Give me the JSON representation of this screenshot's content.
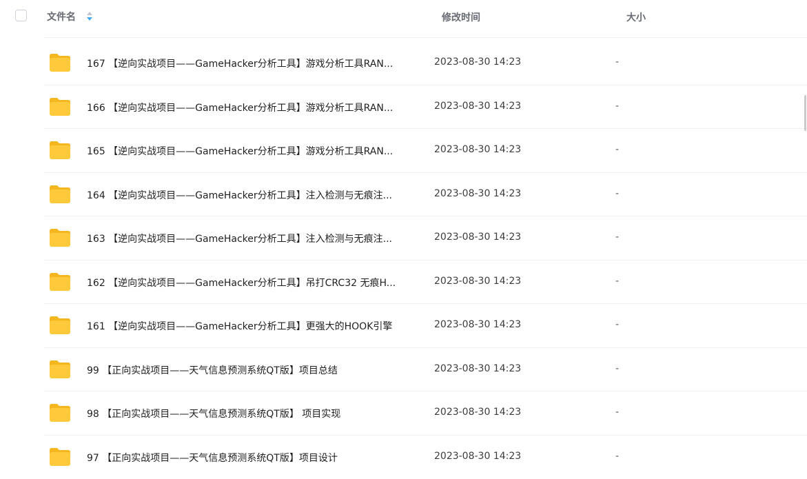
{
  "header": {
    "name_label": "文件名",
    "time_label": "修改时间",
    "size_label": "大小"
  },
  "files": [
    {
      "name": "167 【逆向实战项目——GameHacker分析工具】游戏分析工具RAN...",
      "time": "2023-08-30 14:23",
      "size": "-"
    },
    {
      "name": "166 【逆向实战项目——GameHacker分析工具】游戏分析工具RAN...",
      "time": "2023-08-30 14:23",
      "size": "-"
    },
    {
      "name": "165 【逆向实战项目——GameHacker分析工具】游戏分析工具RAN...",
      "time": "2023-08-30 14:23",
      "size": "-"
    },
    {
      "name": "164 【逆向实战项目——GameHacker分析工具】注入检测与无痕注...",
      "time": "2023-08-30 14:23",
      "size": "-"
    },
    {
      "name": "163 【逆向实战项目——GameHacker分析工具】注入检测与无痕注...",
      "time": "2023-08-30 14:23",
      "size": "-"
    },
    {
      "name": "162 【逆向实战项目——GameHacker分析工具】吊打CRC32 无痕H...",
      "time": "2023-08-30 14:23",
      "size": "-"
    },
    {
      "name": "161 【逆向实战项目——GameHacker分析工具】更强大的HOOK引擎",
      "time": "2023-08-30 14:23",
      "size": "-"
    },
    {
      "name": "99 【正向实战项目——天气信息预测系统QT版】项目总结",
      "time": "2023-08-30 14:23",
      "size": "-"
    },
    {
      "name": "98 【正向实战项目——天气信息预测系统QT版】 项目实现",
      "time": "2023-08-30 14:23",
      "size": "-"
    },
    {
      "name": "97 【正向实战项目——天气信息预测系统QT版】项目设计",
      "time": "2023-08-30 14:23",
      "size": "-"
    }
  ],
  "colors": {
    "folder": "#ffc93c",
    "folder_tab": "#f5b720",
    "sort_up": "#c0c4cc",
    "sort_down": "#3fa9f5"
  },
  "icons": {
    "folder": "folder-icon",
    "sort": "sort-icon",
    "checkbox": "checkbox-icon"
  }
}
